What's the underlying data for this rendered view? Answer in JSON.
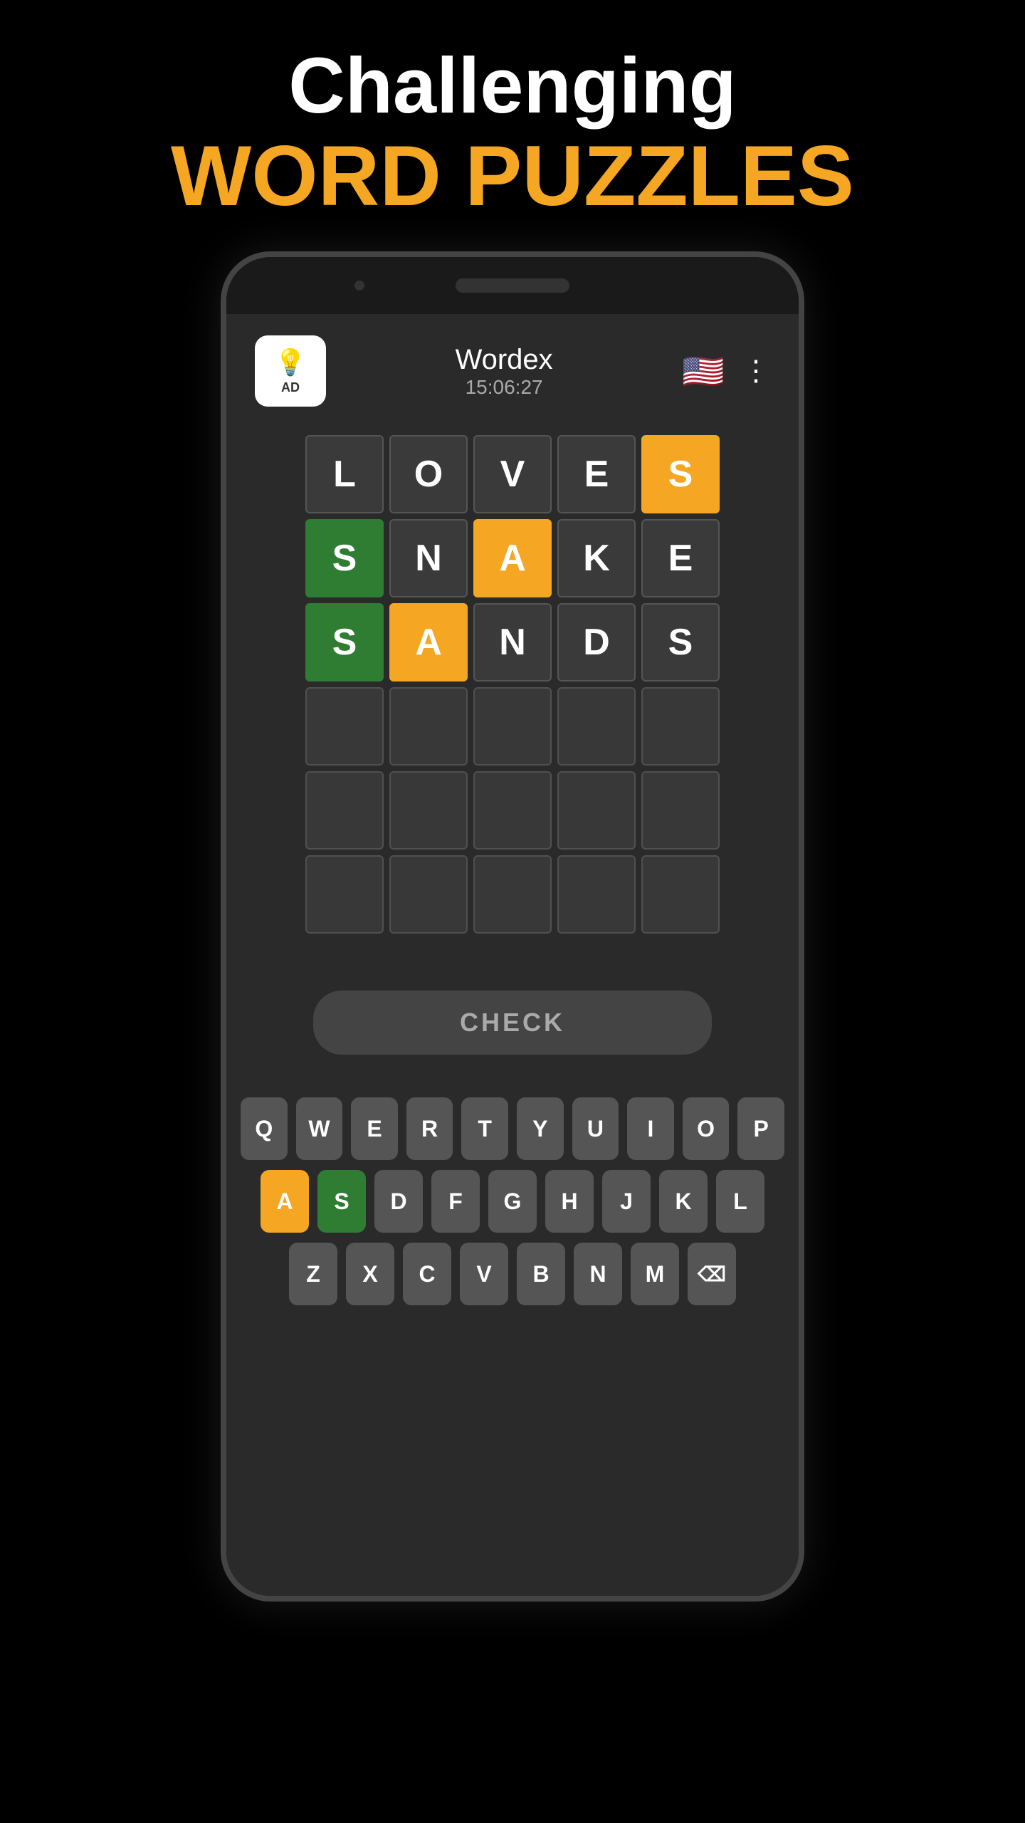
{
  "header": {
    "line1": "Challenging",
    "line2": "WORD PUZZLES"
  },
  "app": {
    "title": "Wordex",
    "timer": "15:06:27",
    "ad_label": "AD",
    "check_button": "CHECK"
  },
  "grid": {
    "rows": [
      [
        {
          "letter": "L",
          "state": "empty"
        },
        {
          "letter": "O",
          "state": "empty"
        },
        {
          "letter": "V",
          "state": "empty"
        },
        {
          "letter": "E",
          "state": "empty"
        },
        {
          "letter": "S",
          "state": "orange"
        }
      ],
      [
        {
          "letter": "S",
          "state": "green"
        },
        {
          "letter": "N",
          "state": "empty"
        },
        {
          "letter": "A",
          "state": "orange"
        },
        {
          "letter": "K",
          "state": "empty"
        },
        {
          "letter": "E",
          "state": "empty"
        }
      ],
      [
        {
          "letter": "S",
          "state": "green"
        },
        {
          "letter": "A",
          "state": "orange"
        },
        {
          "letter": "N",
          "state": "empty"
        },
        {
          "letter": "D",
          "state": "empty"
        },
        {
          "letter": "S",
          "state": "empty"
        }
      ],
      [
        {
          "letter": "",
          "state": "blank"
        },
        {
          "letter": "",
          "state": "blank"
        },
        {
          "letter": "",
          "state": "blank"
        },
        {
          "letter": "",
          "state": "blank"
        },
        {
          "letter": "",
          "state": "blank"
        }
      ],
      [
        {
          "letter": "",
          "state": "blank"
        },
        {
          "letter": "",
          "state": "blank"
        },
        {
          "letter": "",
          "state": "blank"
        },
        {
          "letter": "",
          "state": "blank"
        },
        {
          "letter": "",
          "state": "blank"
        }
      ],
      [
        {
          "letter": "",
          "state": "blank"
        },
        {
          "letter": "",
          "state": "blank"
        },
        {
          "letter": "",
          "state": "blank"
        },
        {
          "letter": "",
          "state": "blank"
        },
        {
          "letter": "",
          "state": "blank"
        }
      ]
    ]
  },
  "keyboard": {
    "rows": [
      [
        "Q",
        "W",
        "E",
        "R",
        "T",
        "Y",
        "U",
        "I",
        "O",
        "P"
      ],
      [
        "A",
        "S",
        "D",
        "F",
        "G",
        "H",
        "J",
        "K",
        "L"
      ],
      [
        "Z",
        "X",
        "C",
        "V",
        "B",
        "N",
        "M",
        "⌫"
      ]
    ],
    "key_states": {
      "A": "orange",
      "S": "green",
      "N": "normal",
      "D": "normal",
      "E": "normal",
      "K": "normal",
      "L": "normal",
      "O": "normal",
      "V": "normal"
    }
  }
}
